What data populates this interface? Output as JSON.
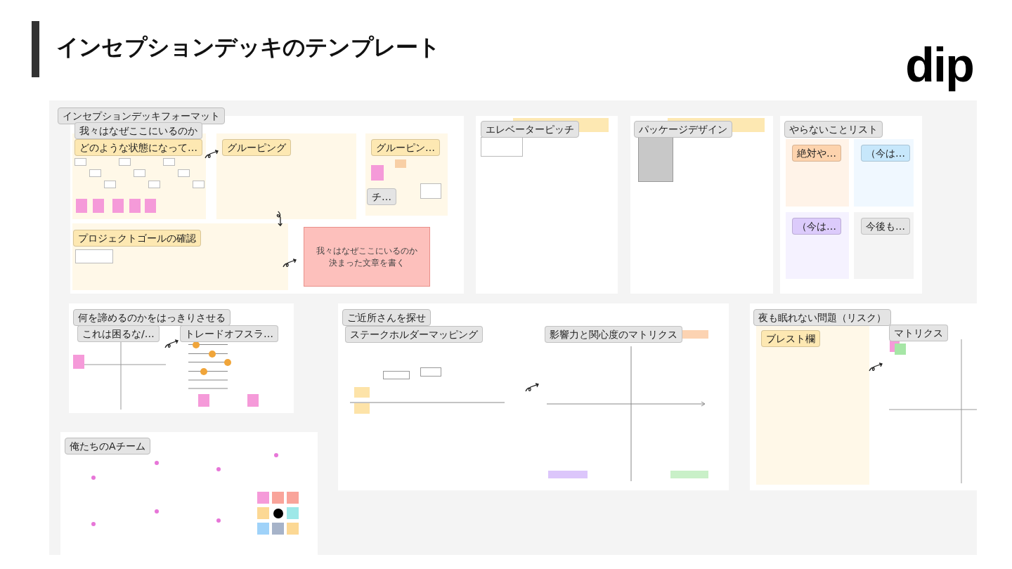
{
  "slide": {
    "title": "インセプションデッキのテンプレート",
    "logo": "dip"
  },
  "frames": [
    {
      "title": "インセプションデッキフォーマット",
      "note": [
        "我々はなぜここにいるのか",
        "決まった文章を書く"
      ],
      "tags": [
        {
          "text": "我々はなぜここにいるのか",
          "color": "#e4e4e4"
        },
        {
          "text": "どのような状態になって…",
          "color": "#fde8b2"
        },
        {
          "text": "グルーピング",
          "color": "#fde8b2"
        },
        {
          "text": "グルーピン…",
          "color": "#fde8b2"
        },
        {
          "text": "チ…",
          "color": "#e4e4e4"
        },
        {
          "text": "プロジェクトゴールの確認",
          "color": "#fde8b2"
        }
      ]
    },
    {
      "title": "エレベーターピッチ"
    },
    {
      "title": "パッケージデザイン"
    },
    {
      "title": "やらないことリスト",
      "tags": [
        {
          "text": "絶対や…",
          "color": "#fdd3ad"
        },
        {
          "text": "（今は…",
          "color": "#c7e7fb"
        },
        {
          "text": "（今は…",
          "color": "#dccbfb"
        },
        {
          "text": "今後も…",
          "color": "#e4e4e4"
        }
      ]
    },
    {
      "title": "何を諦めるのかをはっきりさせる",
      "tags": [
        {
          "text": "これは困るな/…",
          "color": "#e4e4e4"
        },
        {
          "text": "トレードオフスラ…",
          "color": "#e4e4e4"
        }
      ],
      "sliders": [
        {
          "level": 0.2
        },
        {
          "level": 0.6
        },
        {
          "level": 1
        },
        {
          "level": 0.4
        }
      ]
    },
    {
      "title": "俺たちのAチーム"
    },
    {
      "title": "ご近所さんを探せ",
      "tags": [
        {
          "text": "ステークホルダーマッピング",
          "color": "#e4e4e4"
        },
        {
          "text": "影響力と関心度のマトリクス",
          "color": "#e4e4e4"
        }
      ]
    },
    {
      "title": "夜も眠れない問題（リスク）",
      "tags": [
        {
          "text": "ブレスト欄",
          "color": "#fde8b2"
        },
        {
          "text": "マトリクス",
          "color": "#e4e4e4"
        }
      ]
    }
  ]
}
